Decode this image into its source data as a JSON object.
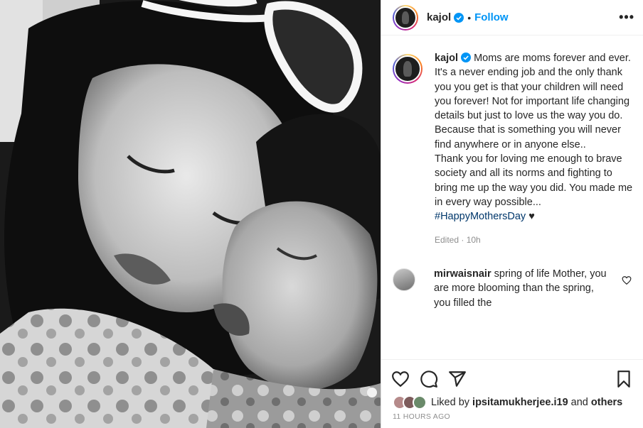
{
  "photo": {
    "description_icon": "portrait-photo"
  },
  "header": {
    "username": "kajol",
    "separator": "•",
    "follow_label": "Follow",
    "more_label": "•••"
  },
  "caption": {
    "username": "kajol",
    "text_lines": [
      "Moms are moms forever and ever. It's a never ending job and the only thank you you get is that your children will need you forever! Not for important life changing details but just to love us the way you do. Because that is something you will never find anywhere or in anyone else..",
      "Thank you for loving me enough to brave society and all its norms and fighting to bring me up the way you did. You made me in every way possible..."
    ],
    "hashtag": "#HappyMothersDay",
    "emoji": "♥",
    "meta": "Edited · 10h"
  },
  "comment": {
    "username": "mirwaisnair",
    "text": "spring of life Mother, you are more blooming than the spring, you filled the"
  },
  "likes": {
    "prefix": "Liked by",
    "user": "ipsitamukherjee.i19",
    "and": "and",
    "others": "others"
  },
  "timestamp": "11 HOURS AGO",
  "colors": {
    "link": "#0095f6",
    "hashtag": "#00376b",
    "muted": "#8e8e8e",
    "verified": "#0095f6"
  }
}
